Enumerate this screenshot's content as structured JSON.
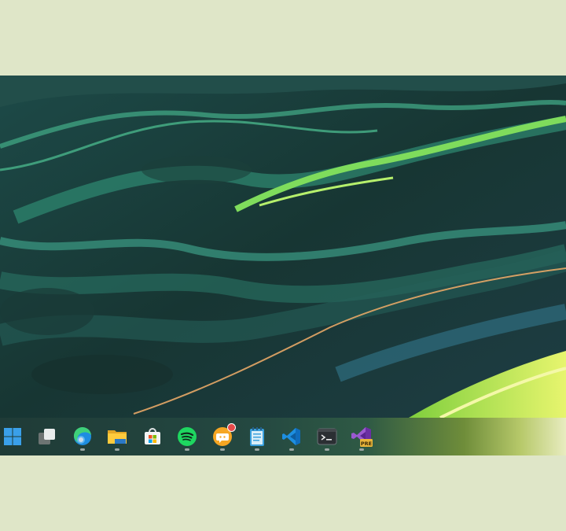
{
  "desktop": {
    "wallpaper": "abstract-green-teal-aerial-river-wallpaper",
    "colors": {
      "background": "#dfe6c8",
      "deep": "#1b3d3c",
      "teal": "#2f8a72",
      "lime": "#8fe05a",
      "yellow": "#dff06a"
    }
  },
  "taskbar": {
    "items": [
      {
        "name": "start-button",
        "icon": "windows-logo-icon",
        "running": false
      },
      {
        "name": "task-view-button",
        "icon": "task-view-icon",
        "running": false
      },
      {
        "name": "edge-button",
        "icon": "edge-icon",
        "running": true
      },
      {
        "name": "file-explorer-button",
        "icon": "folder-icon",
        "running": true
      },
      {
        "name": "microsoft-store-button",
        "icon": "store-icon",
        "running": false
      },
      {
        "name": "spotify-button",
        "icon": "spotify-icon",
        "running": true
      },
      {
        "name": "chat-app-button",
        "icon": "chat-bubble-icon",
        "running": true,
        "badge": true
      },
      {
        "name": "notepad-button",
        "icon": "notepad-icon",
        "running": true
      },
      {
        "name": "vscode-button",
        "icon": "vscode-icon",
        "running": true
      },
      {
        "name": "terminal-button",
        "icon": "terminal-icon",
        "running": true
      },
      {
        "name": "visual-studio-preview-button",
        "icon": "visual-studio-preview-icon",
        "running": true,
        "label": "PRE"
      }
    ]
  }
}
